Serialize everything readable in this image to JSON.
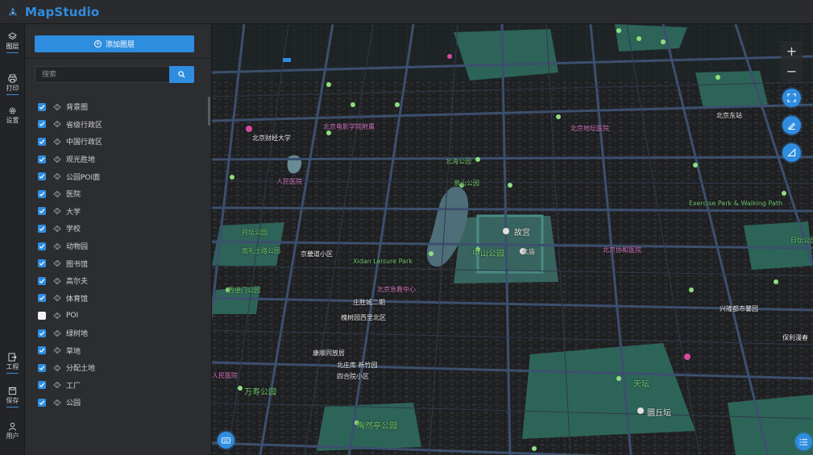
{
  "app": {
    "title": "MapStudio"
  },
  "rail": [
    {
      "label": "图层"
    },
    {
      "label": "打印"
    },
    {
      "label": "设置"
    },
    {
      "label": "工程"
    },
    {
      "label": "保存"
    },
    {
      "label": "用户"
    }
  ],
  "panel": {
    "add_label": "添加图层",
    "search_placeholder": "搜索",
    "layers": [
      {
        "label": "背景图",
        "checked": true
      },
      {
        "label": "省级行政区",
        "checked": true
      },
      {
        "label": "中国行政区",
        "checked": true
      },
      {
        "label": "观光胜地",
        "checked": true
      },
      {
        "label": "公园POI面",
        "checked": true
      },
      {
        "label": "医院",
        "checked": true
      },
      {
        "label": "大学",
        "checked": true
      },
      {
        "label": "学校",
        "checked": true
      },
      {
        "label": "动物园",
        "checked": true
      },
      {
        "label": "图书馆",
        "checked": true
      },
      {
        "label": "高尔夫",
        "checked": true
      },
      {
        "label": "体育馆",
        "checked": true
      },
      {
        "label": "POI",
        "checked": false
      },
      {
        "label": "绿树地",
        "checked": true
      },
      {
        "label": "草地",
        "checked": true
      },
      {
        "label": "分配土地",
        "checked": true
      },
      {
        "label": "工厂",
        "checked": true
      },
      {
        "label": "公园",
        "checked": true
      }
    ]
  },
  "map": {
    "labels": [
      {
        "text": "北京电影学院附属",
        "color": "pink"
      },
      {
        "text": "北京财经大学",
        "color": "white"
      },
      {
        "text": "人民医院",
        "color": "pink"
      },
      {
        "text": "月坛公园",
        "color": "green"
      },
      {
        "text": "南礼士路公园",
        "color": "green"
      },
      {
        "text": "京畿道小区",
        "color": "white"
      },
      {
        "text": "Xidan Leisure Park",
        "color": "green"
      },
      {
        "text": "北京急救中心",
        "color": "pink"
      },
      {
        "text": "西便门公园",
        "color": "green"
      },
      {
        "text": "庄胜城二期",
        "color": "white"
      },
      {
        "text": "槐树园西里北区",
        "color": "white"
      },
      {
        "text": "康顺同放居",
        "color": "white"
      },
      {
        "text": "北庄库 新竹园",
        "color": "white"
      },
      {
        "text": "四合院小区",
        "color": "white"
      },
      {
        "text": "人民医院",
        "color": "pink"
      },
      {
        "text": "万寿公园",
        "color": "green"
      },
      {
        "text": "陶然亭公园",
        "color": "green"
      },
      {
        "text": "中山公园",
        "color": "green"
      },
      {
        "text": "故宫",
        "color": "white"
      },
      {
        "text": "太庙",
        "color": "white"
      },
      {
        "text": "天坛",
        "color": "green"
      },
      {
        "text": "圜丘坛",
        "color": "white"
      },
      {
        "text": "北京协和医院",
        "color": "pink"
      },
      {
        "text": "Exercise Park & Walking Path",
        "color": "green"
      },
      {
        "text": "日坛公园",
        "color": "green"
      },
      {
        "text": "北京东站",
        "color": "white"
      },
      {
        "text": "北京地坛医院",
        "color": "pink"
      },
      {
        "text": "景山公园",
        "color": "green"
      },
      {
        "text": "北海公园",
        "color": "green"
      },
      {
        "text": "保利漫春",
        "color": "white"
      },
      {
        "text": "兴隆都市馨园",
        "color": "white"
      }
    ]
  },
  "colors": {
    "accent": "#2f8de0",
    "park": "#2f6b5e",
    "road": "#3c4f6e"
  }
}
